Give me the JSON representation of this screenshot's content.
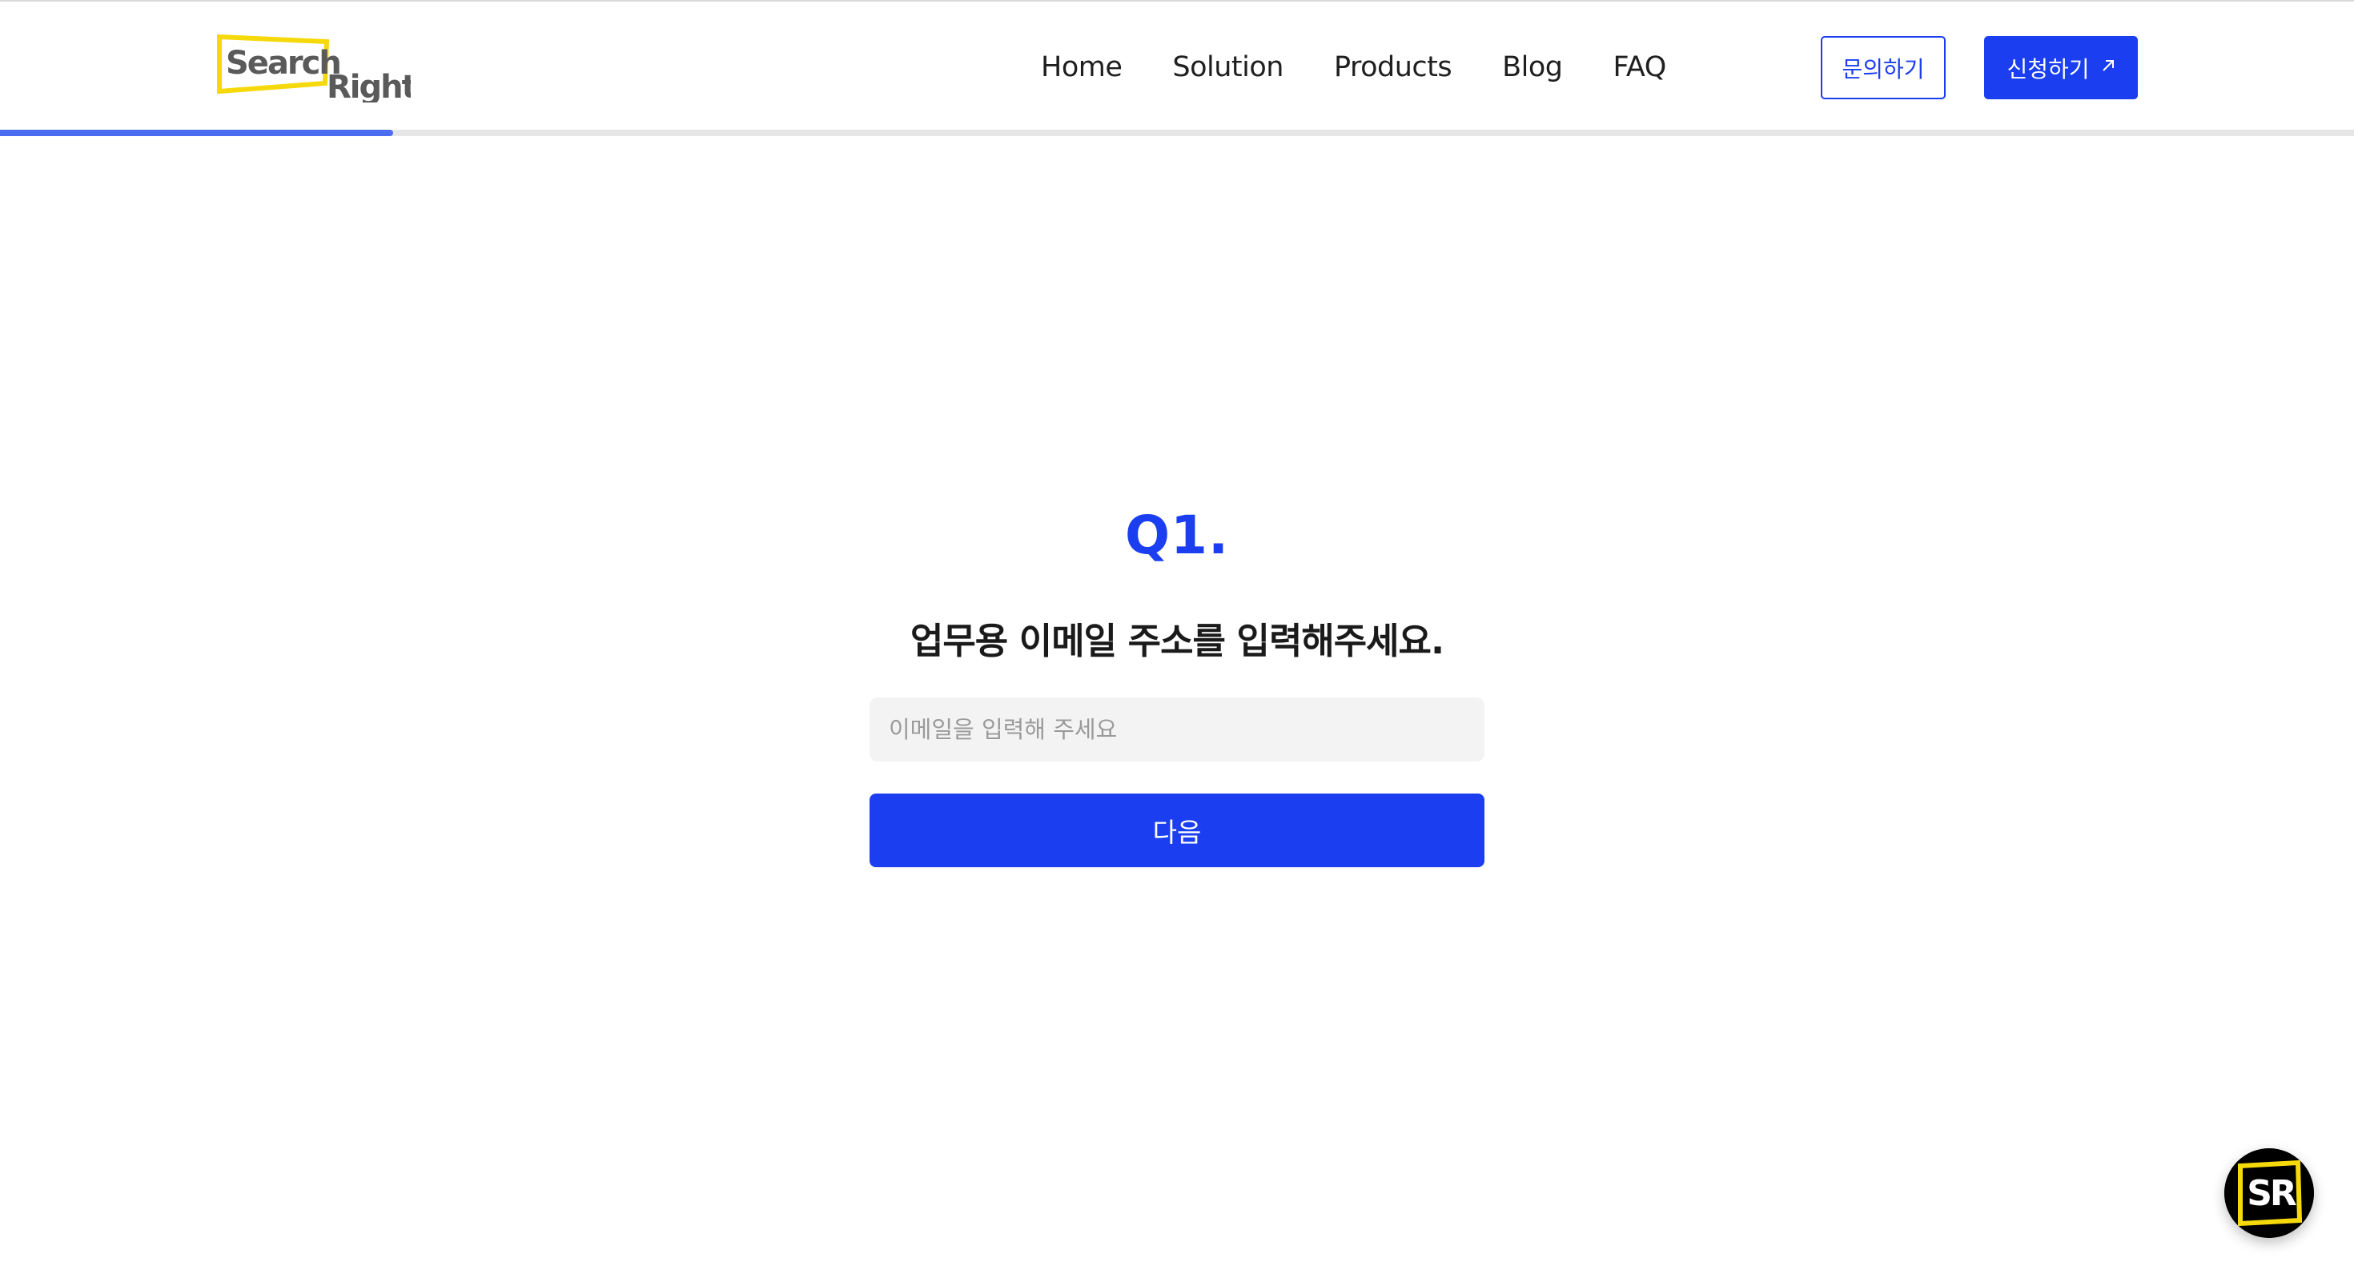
{
  "brand": {
    "logo_text_top": "Search",
    "logo_text_bottom": "Right",
    "logo_accent": "#f5d90a"
  },
  "nav": {
    "items": [
      {
        "label": "Home"
      },
      {
        "label": "Solution"
      },
      {
        "label": "Products"
      },
      {
        "label": "Blog"
      },
      {
        "label": "FAQ"
      }
    ]
  },
  "header_actions": {
    "contact_label": "문의하기",
    "apply_label": "신청하기",
    "apply_icon": "arrow-up-right-icon"
  },
  "progress": {
    "fraction": 0.167,
    "fill_color": "#4a6cf1",
    "track_color": "#e6e6e6"
  },
  "question": {
    "number": "Q1.",
    "text": "업무용 이메일 주소를 입력해주세요.",
    "input_placeholder": "이메일을 입력해 주세요",
    "input_value": "",
    "next_label": "다음"
  },
  "chat_badge": {
    "text": "SR",
    "icon": "search-right-chat-icon"
  },
  "colors": {
    "primary": "#1a3ef0",
    "text": "#1a1a1a",
    "input_bg": "#f3f3f3"
  }
}
